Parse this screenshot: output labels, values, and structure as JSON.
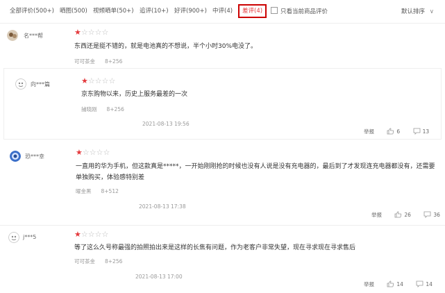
{
  "filters": {
    "all": "全部评价(500+)",
    "photos": "晒图(500)",
    "video": "视频晒单(50+)",
    "followup": "追评(10+)",
    "good": "好评(900+)",
    "medium": "中评(4)",
    "bad": "差评(4)",
    "only_current": "只看当前商品评价",
    "sort": "默认排序",
    "sort_chevron": "∨"
  },
  "reviews": [
    {
      "user": "名***帮",
      "rating": 1,
      "content": "东西还是挺不错的，就是电池真的不想说，半个小时30%电没了。",
      "meta_left": "可可茶金",
      "meta_right": "8+256"
    },
    {
      "user": "向***篇",
      "rating": 1,
      "content": "京东购物以来，历史上服务最差的一次",
      "meta_left": "捕晓刚",
      "meta_right": "8+256",
      "date": "2021-08-13 19:56",
      "report": "举报",
      "likes": "6",
      "replies": "13"
    },
    {
      "user": "恐***幸",
      "rating": 1,
      "content": "一直用的华为手机，但这款真是*****，一开始刚刚抢的时候也没有人说是没有充电器的，最后到了才发现连充电器都没有，还需要单独购买，体验感特别差",
      "meta_left": "曜金黑",
      "meta_right": "8+512",
      "date": "2021-08-13 17:38",
      "report": "举报",
      "likes": "26",
      "replies": "36"
    },
    {
      "user": "j***5",
      "rating": 1,
      "content": "等了这么久号称最强的拍照拍出来是这样的长焦有问题，作为老客户非常失望，现在寻求现在寻求售后",
      "meta_left": "可可茶金",
      "meta_right": "8+256",
      "date": "2021-08-13 17:00",
      "report": "举报",
      "likes": "14",
      "replies": "14"
    }
  ],
  "colors": {
    "accent": "#e4393c",
    "highlight_border": "#cc0000"
  }
}
